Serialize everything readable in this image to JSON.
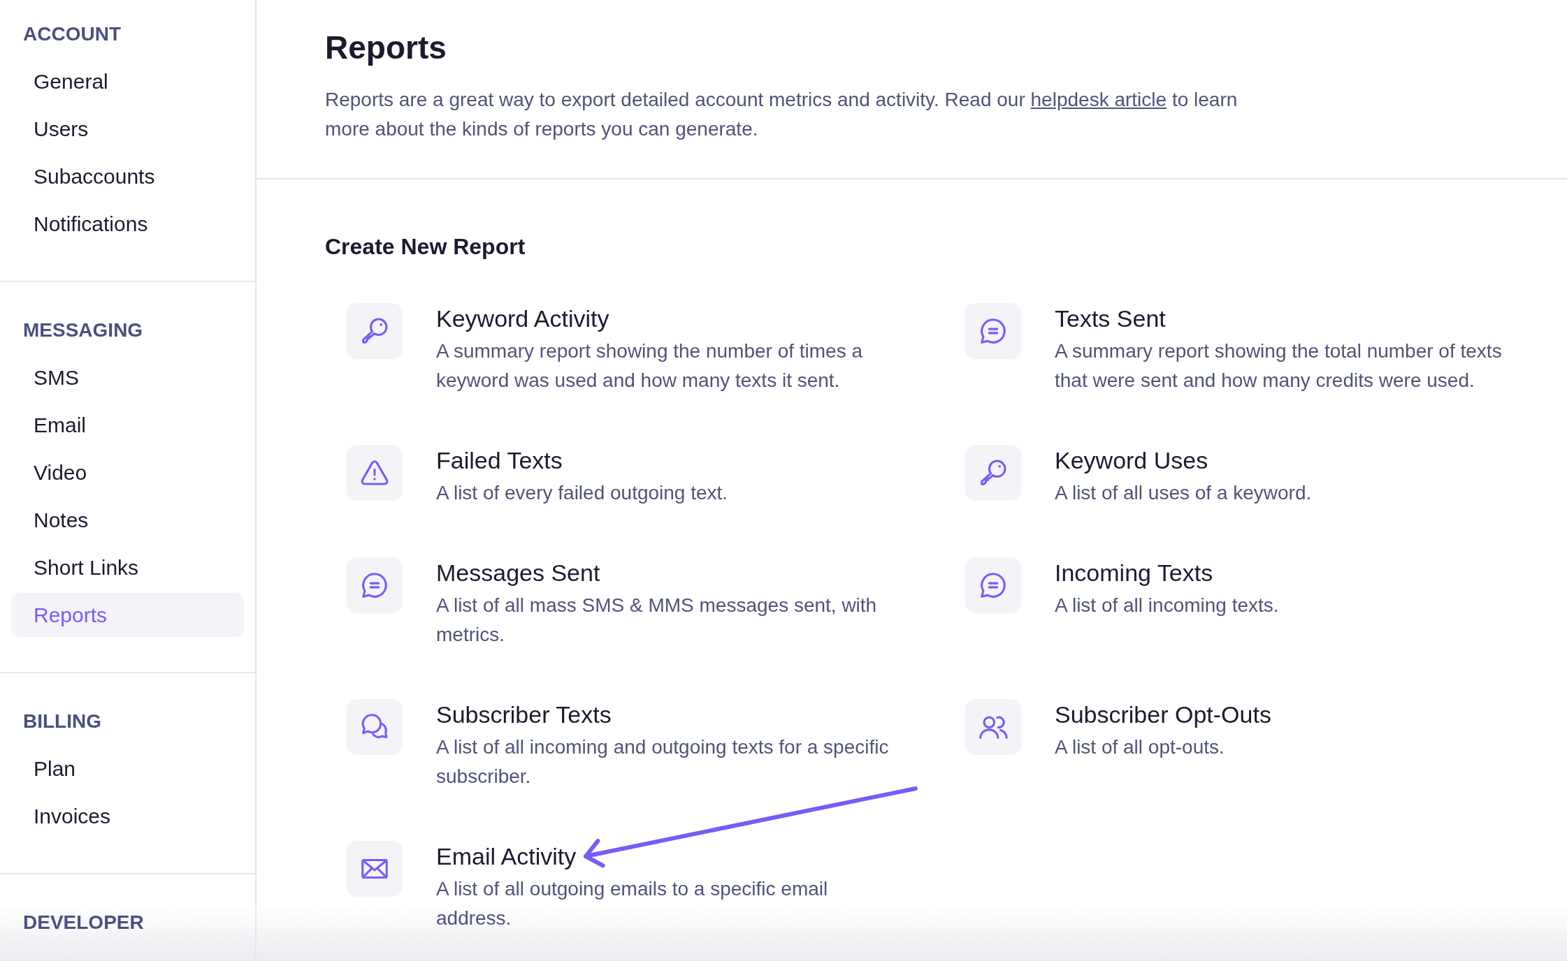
{
  "sidebar": {
    "sections": [
      {
        "title": "ACCOUNT",
        "items": [
          {
            "label": "General",
            "selected": false
          },
          {
            "label": "Users",
            "selected": false
          },
          {
            "label": "Subaccounts",
            "selected": false
          },
          {
            "label": "Notifications",
            "selected": false
          }
        ]
      },
      {
        "title": "MESSAGING",
        "items": [
          {
            "label": "SMS",
            "selected": false
          },
          {
            "label": "Email",
            "selected": false
          },
          {
            "label": "Video",
            "selected": false
          },
          {
            "label": "Notes",
            "selected": false
          },
          {
            "label": "Short Links",
            "selected": false
          },
          {
            "label": "Reports",
            "selected": true
          }
        ]
      },
      {
        "title": "BILLING",
        "items": [
          {
            "label": "Plan",
            "selected": false
          },
          {
            "label": "Invoices",
            "selected": false
          }
        ]
      },
      {
        "title": "DEVELOPER"
      }
    ]
  },
  "page": {
    "title": "Reports",
    "description": {
      "text_before": "Reports are a great way to export detailed account metrics and activity. Read our ",
      "link": "helpdesk article",
      "text_after": " to learn more about the kinds of reports you can generate."
    }
  },
  "reports": {
    "title": "Create New Report",
    "items": [
      {
        "kind": "key",
        "title": "Keyword Activity",
        "description": "A summary report showing the number of times a keyword was used and how many texts it sent.",
        "arrow": false
      },
      {
        "kind": "message",
        "title": "Texts Sent",
        "description": "A summary report showing the total number of texts that were sent and how many credits were used.",
        "arrow": false
      },
      {
        "kind": "alert",
        "title": "Failed Texts",
        "description": "A list of every failed outgoing text.",
        "arrow": false
      },
      {
        "kind": "key",
        "title": "Keyword Uses",
        "description": "A list of all uses of a keyword.",
        "arrow": false
      },
      {
        "kind": "message",
        "title": "Messages Sent",
        "description": "A list of all mass SMS & MMS messages sent, with metrics.",
        "arrow": false
      },
      {
        "kind": "message",
        "title": "Incoming Texts",
        "description": "A list of all incoming texts.",
        "arrow": false
      },
      {
        "kind": "conversation",
        "title": "Subscriber Texts",
        "description": "A list of all incoming and outgoing texts for a specific subscriber.",
        "arrow": false
      },
      {
        "kind": "people",
        "title": "Subscriber Opt-Outs",
        "description": "A list of all opt-outs.",
        "arrow": false
      },
      {
        "kind": "email",
        "title": "Email Activity",
        "description": "A list of all outgoing emails to a specific email address.",
        "arrow": true
      }
    ]
  }
}
